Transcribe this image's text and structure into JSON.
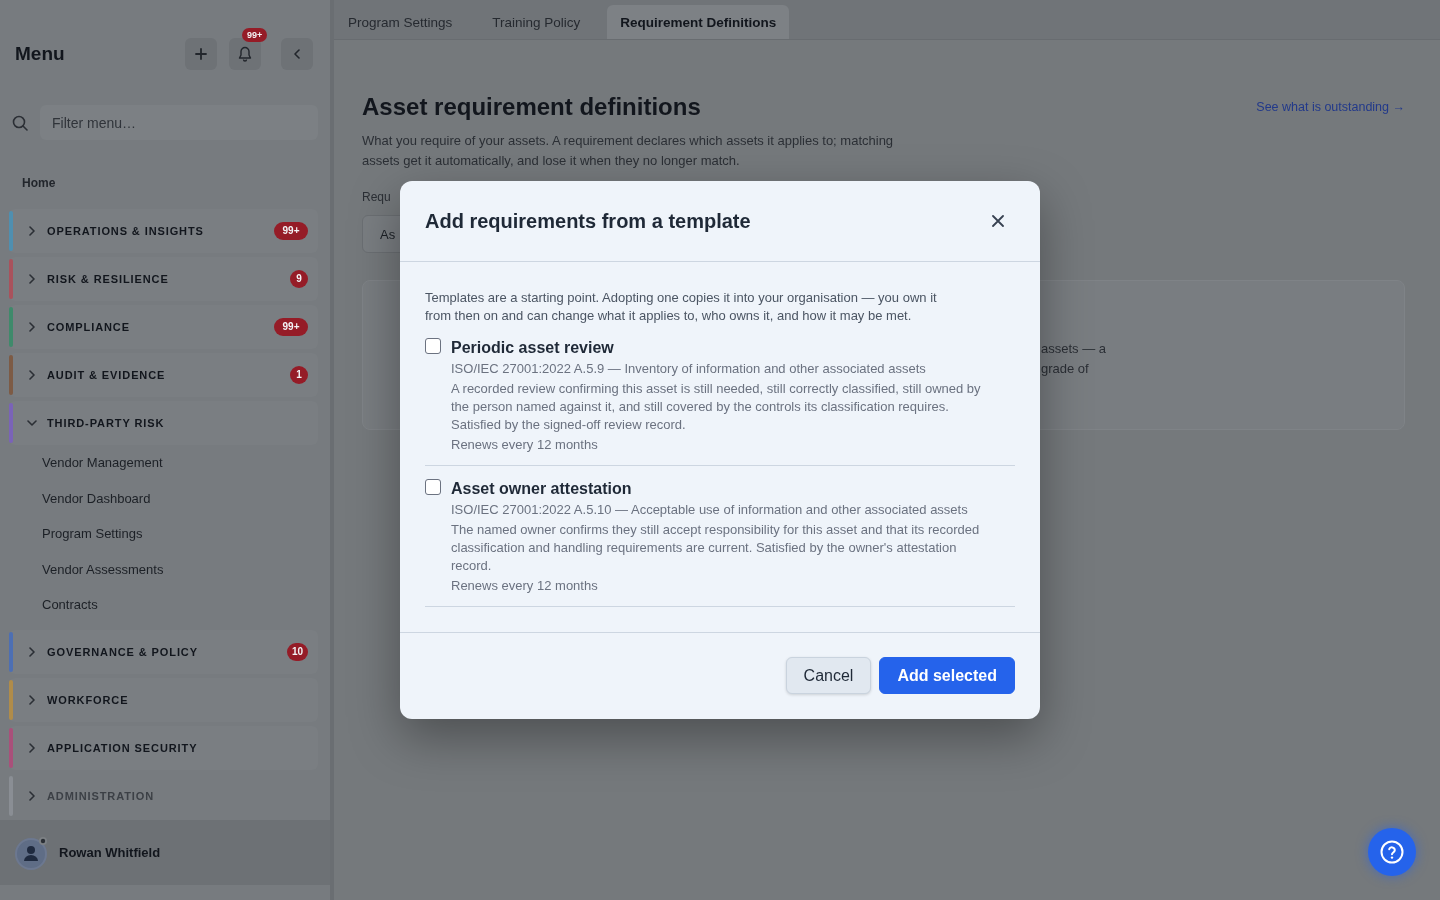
{
  "sidebar": {
    "title": "Menu",
    "notifications_badge": "99+",
    "filter": {
      "placeholder": "Filter menu…"
    },
    "home": "Home",
    "groups": [
      {
        "label": "OPERATIONS & INSIGHTS",
        "color": "#4f8fb0",
        "expanded": false,
        "disabled": false,
        "badge": "99+"
      },
      {
        "label": "RISK & RESILIENCE",
        "color": "#a9525c",
        "expanded": false,
        "disabled": false,
        "badge": "9"
      },
      {
        "label": "COMPLIANCE",
        "color": "#3f8a6b",
        "expanded": false,
        "disabled": false,
        "badge": "99+"
      },
      {
        "label": "AUDIT & EVIDENCE",
        "color": "#7d5b45",
        "expanded": false,
        "disabled": false,
        "badge": "1"
      },
      {
        "label": "THIRD-PARTY RISK",
        "color": "#7a63b8",
        "expanded": true,
        "disabled": false,
        "children": [
          {
            "label": "Vendor Management"
          },
          {
            "label": "Vendor Dashboard"
          },
          {
            "label": "Program Settings"
          },
          {
            "label": "Vendor Assessments"
          },
          {
            "label": "Contracts"
          }
        ]
      },
      {
        "label": "GOVERNANCE & POLICY",
        "color": "#4d6fb3",
        "expanded": false,
        "disabled": false,
        "badge": "10"
      },
      {
        "label": "WORKFORCE",
        "color": "#b08c4a",
        "expanded": false,
        "disabled": false
      },
      {
        "label": "APPLICATION SECURITY",
        "color": "#a9507a",
        "expanded": false,
        "disabled": false
      },
      {
        "label": "ADMINISTRATION",
        "color": "#8a8e94",
        "expanded": false,
        "disabled": true
      }
    ],
    "user": {
      "name": "Rowan Whitfield"
    }
  },
  "tabs": [
    {
      "label": "Program Settings",
      "selected": false
    },
    {
      "label": "Training Policy",
      "selected": false
    },
    {
      "label": "Requirement Definitions",
      "selected": true
    }
  ],
  "page": {
    "title": "Asset requirement definitions",
    "description": "What you require of your assets. A requirement declares which assets it applies to; matching assets get it automatically, and lose it when they no longer match.",
    "link": "See what is outstanding →",
    "section_label": "Requ",
    "control_label": "As",
    "card_lines": [
      "assets — a",
      "grade of"
    ]
  },
  "dialog": {
    "title": "Add requirements from a template",
    "intro": "Templates are a starting point. Adopting one copies it into your organisation — you own it from then on and can change what it applies to, who owns it, and how it may be met.",
    "templates": [
      {
        "title": "Periodic asset review",
        "reference": "ISO/IEC 27001:2022 A.5.9 — Inventory of information and other associated assets",
        "description": "A recorded review confirming this asset is still needed, still correctly classified, still owned by the person named against it, and still covered by the controls its classification requires. Satisfied by the signed-off review record.",
        "renewal": "Renews every 12 months",
        "checked": false
      },
      {
        "title": "Asset owner attestation",
        "reference": "ISO/IEC 27001:2022 A.5.10 — Acceptable use of information and other associated assets",
        "description": "The named owner confirms they still accept responsibility for this asset and that its recorded classification and handling requirements are current. Satisfied by the owner's attestation record.",
        "renewal": "Renews every 12 months",
        "checked": false
      }
    ],
    "buttons": [
      {
        "label": "Cancel",
        "kind": "secondary"
      },
      {
        "label": "Add selected",
        "kind": "primary"
      }
    ]
  }
}
